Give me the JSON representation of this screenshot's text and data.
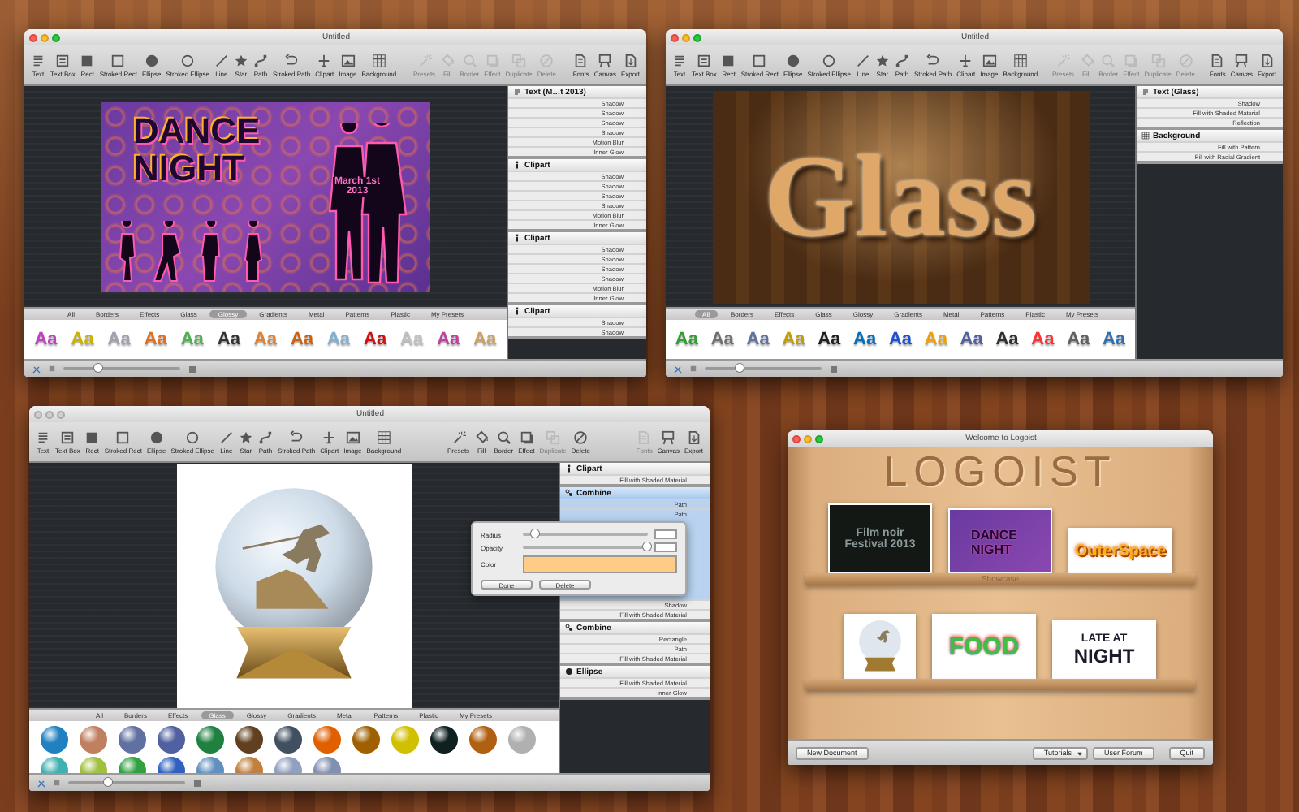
{
  "editors": [
    {
      "title": "Untitled",
      "active": true,
      "toolbar": [
        {
          "items": [
            {
              "label": "Text",
              "disabled": false
            },
            {
              "label": "Text Box",
              "disabled": false
            },
            {
              "label": "Rect",
              "disabled": false
            },
            {
              "label": "Stroked Rect",
              "disabled": false
            },
            {
              "label": "Ellipse",
              "disabled": false
            },
            {
              "label": "Stroked Ellipse",
              "disabled": false
            },
            {
              "label": "Line",
              "disabled": false
            },
            {
              "label": "Star",
              "disabled": false
            },
            {
              "label": "Path",
              "disabled": false
            },
            {
              "label": "Stroked Path",
              "disabled": false
            },
            {
              "label": "Clipart",
              "disabled": false
            },
            {
              "label": "Image",
              "disabled": false
            },
            {
              "label": "Background",
              "disabled": false
            }
          ]
        },
        {
          "items": [
            {
              "label": "Presets",
              "disabled": true
            },
            {
              "label": "Fill",
              "disabled": true
            },
            {
              "label": "Border",
              "disabled": true
            },
            {
              "label": "Effect",
              "disabled": true
            },
            {
              "label": "Duplicate",
              "disabled": true
            },
            {
              "label": "Delete",
              "disabled": true
            }
          ]
        },
        {
          "items": [
            {
              "label": "Fonts",
              "disabled": false
            },
            {
              "label": "Canvas",
              "disabled": false
            },
            {
              "label": "Export",
              "disabled": false
            }
          ]
        }
      ],
      "artwork": {
        "kind": "dance",
        "lines": [
          "DANCE",
          "NIGHT"
        ],
        "date": [
          "March 1st",
          "2013"
        ]
      },
      "preset_tabs": [
        {
          "label": "All",
          "selected": false
        },
        {
          "label": "Borders",
          "selected": false
        },
        {
          "label": "Effects",
          "selected": false
        },
        {
          "label": "Glass",
          "selected": false
        },
        {
          "label": "Glossy",
          "selected": true
        },
        {
          "label": "Gradients",
          "selected": false
        },
        {
          "label": "Metal",
          "selected": false
        },
        {
          "label": "Patterns",
          "selected": false
        },
        {
          "label": "Plastic",
          "selected": false
        },
        {
          "label": "My Presets",
          "selected": false
        }
      ],
      "presets": [
        {
          "kind": "text",
          "label": "Aa",
          "color": "#c040c0"
        },
        {
          "kind": "text",
          "label": "Aa",
          "color": "#c8b400"
        },
        {
          "kind": "text",
          "label": "Aa",
          "color": "#a0a0b0"
        },
        {
          "kind": "text",
          "label": "Aa",
          "color": "#e07020"
        },
        {
          "kind": "text",
          "label": "Aa",
          "color": "#50b050"
        },
        {
          "kind": "text",
          "label": "Aa",
          "color": "#333333"
        },
        {
          "kind": "text",
          "label": "Aa",
          "color": "#e08030"
        },
        {
          "kind": "text",
          "label": "Aa",
          "color": "#d06010"
        },
        {
          "kind": "text",
          "label": "Aa",
          "color": "#80b0d0"
        },
        {
          "kind": "text",
          "label": "Aa",
          "color": "#d01010"
        },
        {
          "kind": "text",
          "label": "Aa",
          "color": "#c0c0c0"
        },
        {
          "kind": "text",
          "label": "Aa",
          "color": "#c040a0"
        },
        {
          "kind": "text",
          "label": "Aa",
          "color": "#d0a060"
        }
      ],
      "layers": [
        {
          "kind": "text",
          "name": "Text (M…t 2013)",
          "selected": false,
          "effects": [
            {
              "label": "Shadow",
              "selected": false
            },
            {
              "label": "Shadow",
              "selected": false
            },
            {
              "label": "Shadow",
              "selected": false
            },
            {
              "label": "Shadow",
              "selected": false
            },
            {
              "label": "Motion Blur",
              "selected": false
            },
            {
              "label": "Inner Glow",
              "selected": false
            }
          ]
        },
        {
          "kind": "clipart",
          "name": "Clipart",
          "selected": false,
          "effects": [
            {
              "label": "Shadow",
              "selected": false
            },
            {
              "label": "Shadow",
              "selected": false
            },
            {
              "label": "Shadow",
              "selected": false
            },
            {
              "label": "Shadow",
              "selected": false
            },
            {
              "label": "Motion Blur",
              "selected": false
            },
            {
              "label": "Inner Glow",
              "selected": false
            }
          ]
        },
        {
          "kind": "clipart",
          "name": "Clipart",
          "selected": false,
          "effects": [
            {
              "label": "Shadow",
              "selected": false
            },
            {
              "label": "Shadow",
              "selected": false
            },
            {
              "label": "Shadow",
              "selected": false
            },
            {
              "label": "Shadow",
              "selected": false
            },
            {
              "label": "Motion Blur",
              "selected": false
            },
            {
              "label": "Inner Glow",
              "selected": false
            }
          ]
        },
        {
          "kind": "clipart",
          "name": "Clipart",
          "selected": false,
          "effects": [
            {
              "label": "Shadow",
              "selected": false
            },
            {
              "label": "Shadow",
              "selected": false
            }
          ]
        }
      ],
      "zoom": {
        "level": 0.3
      }
    },
    {
      "title": "Untitled",
      "active": true,
      "toolbar": [
        {
          "items": [
            {
              "label": "Text",
              "disabled": false
            },
            {
              "label": "Text Box",
              "disabled": false
            },
            {
              "label": "Rect",
              "disabled": false
            },
            {
              "label": "Stroked Rect",
              "disabled": false
            },
            {
              "label": "Ellipse",
              "disabled": false
            },
            {
              "label": "Stroked Ellipse",
              "disabled": false
            },
            {
              "label": "Line",
              "disabled": false
            },
            {
              "label": "Star",
              "disabled": false
            },
            {
              "label": "Path",
              "disabled": false
            },
            {
              "label": "Stroked Path",
              "disabled": false
            },
            {
              "label": "Clipart",
              "disabled": false
            },
            {
              "label": "Image",
              "disabled": false
            },
            {
              "label": "Background",
              "disabled": false
            }
          ]
        },
        {
          "items": [
            {
              "label": "Presets",
              "disabled": true
            },
            {
              "label": "Fill",
              "disabled": true
            },
            {
              "label": "Border",
              "disabled": true
            },
            {
              "label": "Effect",
              "disabled": true
            },
            {
              "label": "Duplicate",
              "disabled": true
            },
            {
              "label": "Delete",
              "disabled": true
            }
          ]
        },
        {
          "items": [
            {
              "label": "Fonts",
              "disabled": false
            },
            {
              "label": "Canvas",
              "disabled": false
            },
            {
              "label": "Export",
              "disabled": false
            }
          ]
        }
      ],
      "artwork": {
        "kind": "glass",
        "lines": [
          "Glass"
        ]
      },
      "preset_tabs": [
        {
          "label": "All",
          "selected": true
        },
        {
          "label": "Borders",
          "selected": false
        },
        {
          "label": "Effects",
          "selected": false
        },
        {
          "label": "Glass",
          "selected": false
        },
        {
          "label": "Glossy",
          "selected": false
        },
        {
          "label": "Gradients",
          "selected": false
        },
        {
          "label": "Metal",
          "selected": false
        },
        {
          "label": "Patterns",
          "selected": false
        },
        {
          "label": "Plastic",
          "selected": false
        },
        {
          "label": "My Presets",
          "selected": false
        }
      ],
      "presets": [
        {
          "kind": "text",
          "label": "Aa",
          "color": "#30a030"
        },
        {
          "kind": "text",
          "label": "Aa",
          "color": "#707070"
        },
        {
          "kind": "text",
          "label": "Aa",
          "color": "#6070a0"
        },
        {
          "kind": "text",
          "label": "Aa",
          "color": "#c0a000"
        },
        {
          "kind": "text",
          "label": "Aa",
          "color": "#202020"
        },
        {
          "kind": "text",
          "label": "Aa",
          "color": "#0070c0"
        },
        {
          "kind": "text",
          "label": "Aa",
          "color": "#2050d0"
        },
        {
          "kind": "text",
          "label": "Aa",
          "color": "#f0a000"
        },
        {
          "kind": "text",
          "label": "Aa",
          "color": "#5060a0"
        },
        {
          "kind": "text",
          "label": "Aa",
          "color": "#303030"
        },
        {
          "kind": "text",
          "label": "Aa",
          "color": "#ff3030"
        },
        {
          "kind": "text",
          "label": "Aa",
          "color": "#606060"
        },
        {
          "kind": "text",
          "label": "Aa",
          "color": "#3070b0"
        }
      ],
      "layers": [
        {
          "kind": "text",
          "name": "Text (Glass)",
          "selected": false,
          "effects": [
            {
              "label": "Shadow",
              "selected": false
            },
            {
              "label": "Fill with Shaded Material",
              "selected": false
            },
            {
              "label": "Reflection",
              "selected": false
            }
          ]
        },
        {
          "kind": "background",
          "name": "Background",
          "selected": false,
          "effects": [
            {
              "label": "Fill with Pattern",
              "selected": false
            },
            {
              "label": "Fill with Radial Gradient",
              "selected": false
            }
          ]
        }
      ],
      "zoom": {
        "level": 0.3
      }
    },
    {
      "title": "Untitled",
      "active": false,
      "toolbar": [
        {
          "items": [
            {
              "label": "Text",
              "disabled": false
            },
            {
              "label": "Text Box",
              "disabled": false
            },
            {
              "label": "Rect",
              "disabled": false
            },
            {
              "label": "Stroked Rect",
              "disabled": false
            },
            {
              "label": "Ellipse",
              "disabled": false
            },
            {
              "label": "Stroked Ellipse",
              "disabled": false
            },
            {
              "label": "Line",
              "disabled": false
            },
            {
              "label": "Star",
              "disabled": false
            },
            {
              "label": "Path",
              "disabled": false
            },
            {
              "label": "Stroked Path",
              "disabled": false
            },
            {
              "label": "Clipart",
              "disabled": false
            },
            {
              "label": "Image",
              "disabled": false
            },
            {
              "label": "Background",
              "disabled": false
            }
          ]
        },
        {
          "items": [
            {
              "label": "Presets",
              "disabled": false
            },
            {
              "label": "Fill",
              "disabled": false
            },
            {
              "label": "Border",
              "disabled": false
            },
            {
              "label": "Effect",
              "disabled": false
            },
            {
              "label": "Duplicate",
              "disabled": true
            },
            {
              "label": "Delete",
              "disabled": false
            }
          ]
        },
        {
          "items": [
            {
              "label": "Fonts",
              "disabled": true
            },
            {
              "label": "Canvas",
              "disabled": false
            },
            {
              "label": "Export",
              "disabled": false
            }
          ]
        }
      ],
      "artwork": {
        "kind": "globe"
      },
      "preset_tabs": [
        {
          "label": "All",
          "selected": false
        },
        {
          "label": "Borders",
          "selected": false
        },
        {
          "label": "Effects",
          "selected": false
        },
        {
          "label": "Glass",
          "selected": true
        },
        {
          "label": "Glossy",
          "selected": false
        },
        {
          "label": "Gradients",
          "selected": false
        },
        {
          "label": "Metal",
          "selected": false
        },
        {
          "label": "Patterns",
          "selected": false
        },
        {
          "label": "Plastic",
          "selected": false
        },
        {
          "label": "My Presets",
          "selected": false
        }
      ],
      "presets": [
        {
          "kind": "sphere",
          "color": "#2080c0"
        },
        {
          "kind": "sphere",
          "color": "#c08060"
        },
        {
          "kind": "sphere",
          "color": "#6070a0"
        },
        {
          "kind": "sphere",
          "color": "#5060a0"
        },
        {
          "kind": "sphere",
          "color": "#208040"
        },
        {
          "kind": "sphere",
          "color": "#604020"
        },
        {
          "kind": "sphere",
          "color": "#405060"
        },
        {
          "kind": "sphere",
          "color": "#e06000"
        },
        {
          "kind": "sphere",
          "color": "#a06000"
        },
        {
          "kind": "sphere",
          "color": "#d0c000"
        },
        {
          "kind": "sphere",
          "color": "#102020"
        },
        {
          "kind": "sphere",
          "color": "#b06010"
        },
        {
          "kind": "sphere",
          "color": "#b0b0b0"
        },
        {
          "kind": "sphere",
          "color": "#40b0b0"
        },
        {
          "kind": "sphere",
          "color": "#a0c040"
        },
        {
          "kind": "sphere",
          "color": "#30a040"
        },
        {
          "kind": "sphere",
          "color": "#3060c0"
        },
        {
          "kind": "sphere",
          "color": "#6090c0"
        },
        {
          "kind": "sphere",
          "color": "#c08040"
        },
        {
          "kind": "sphere",
          "color": "#90a0c0"
        },
        {
          "kind": "sphere",
          "color": "#8090b0"
        }
      ],
      "layers": [
        {
          "kind": "clipart",
          "name": "Clipart",
          "selected": false,
          "effects": [
            {
              "label": "Fill with Shaded Material",
              "selected": false
            }
          ]
        },
        {
          "kind": "combine",
          "name": "Combine",
          "selected": true,
          "effects": [
            {
              "label": "Path",
              "selected": true
            },
            {
              "label": "Path",
              "selected": true
            },
            {
              "label": "Shadow",
              "selected": false
            },
            {
              "label": "Fill with Shaded Material",
              "selected": false
            }
          ]
        },
        {
          "kind": "combine",
          "name": "Combine",
          "selected": false,
          "effects": [
            {
              "label": "Rectangle",
              "selected": false
            },
            {
              "label": "Path",
              "selected": false
            },
            {
              "label": "Fill with Shaded Material",
              "selected": false
            }
          ]
        },
        {
          "kind": "ellipse",
          "name": "Ellipse",
          "selected": false,
          "effects": [
            {
              "label": "Fill with Shaded Material",
              "selected": false
            },
            {
              "label": "Inner Glow",
              "selected": false
            }
          ]
        }
      ],
      "popover": {
        "fields": [
          {
            "kind": "slider",
            "label": "Radius",
            "level": 0.1
          },
          {
            "kind": "slider",
            "label": "Opacity",
            "level": 1.0
          },
          {
            "kind": "color",
            "label": "Color",
            "color": "#ffcc88"
          }
        ],
        "buttons": [
          "Done",
          "Delete"
        ]
      },
      "zoom": {
        "level": 0.35
      }
    }
  ],
  "welcome": {
    "title": "Welcome to Logoist",
    "active": true,
    "heading": "LOGOIST",
    "shelf_label": "Showcase",
    "thumbnails": [
      {
        "kind": "noir",
        "lines": [
          "Film noir",
          "Festival 2013"
        ]
      },
      {
        "kind": "dance",
        "lines": [
          "DANCE",
          "NIGHT"
        ]
      },
      {
        "kind": "space",
        "lines": [
          "OuterSpace"
        ]
      },
      {
        "kind": "globe"
      },
      {
        "kind": "food",
        "lines": [
          "FOOD"
        ]
      },
      {
        "kind": "late",
        "lines": [
          "LATE AT",
          "NIGHT"
        ]
      }
    ],
    "buttons": [
      {
        "kind": "push",
        "label": "New Document"
      },
      {
        "kind": "popup",
        "label": "Tutorials"
      },
      {
        "kind": "push",
        "label": "User Forum"
      },
      {
        "kind": "push",
        "label": "Quit"
      }
    ]
  }
}
